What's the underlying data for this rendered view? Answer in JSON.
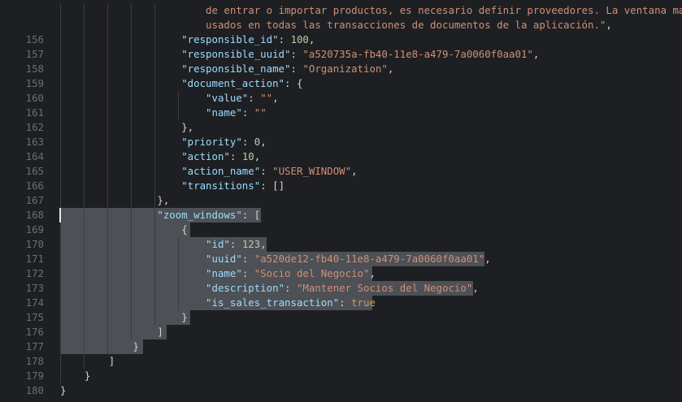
{
  "lines": [
    {
      "no": "",
      "indent": "                        ",
      "tokens": [
        {
          "t": "s",
          "v": "de entrar o importar productos, es necesario definir proveedores. La ventana mantie"
        }
      ]
    },
    {
      "no": "",
      "indent": "                        ",
      "tokens": [
        {
          "t": "s",
          "v": "usados en todas las transacciones de documentos de la aplicación.\""
        },
        {
          "t": "p",
          "v": ","
        }
      ]
    },
    {
      "no": "156",
      "indent": "                    ",
      "tokens": [
        {
          "t": "k",
          "v": "\"responsible_id\""
        },
        {
          "t": "p",
          "v": ": "
        },
        {
          "t": "n",
          "v": "100"
        },
        {
          "t": "p",
          "v": ","
        }
      ]
    },
    {
      "no": "157",
      "indent": "                    ",
      "tokens": [
        {
          "t": "k",
          "v": "\"responsible_uuid\""
        },
        {
          "t": "p",
          "v": ": "
        },
        {
          "t": "s",
          "v": "\"a520735a-fb40-11e8-a479-7a0060f0aa01\""
        },
        {
          "t": "p",
          "v": ","
        }
      ]
    },
    {
      "no": "158",
      "indent": "                    ",
      "tokens": [
        {
          "t": "k",
          "v": "\"responsible_name\""
        },
        {
          "t": "p",
          "v": ": "
        },
        {
          "t": "s",
          "v": "\"Organization\""
        },
        {
          "t": "p",
          "v": ","
        }
      ]
    },
    {
      "no": "159",
      "indent": "                    ",
      "tokens": [
        {
          "t": "k",
          "v": "\"document_action\""
        },
        {
          "t": "p",
          "v": ": {"
        }
      ]
    },
    {
      "no": "160",
      "indent": "                        ",
      "tokens": [
        {
          "t": "k",
          "v": "\"value\""
        },
        {
          "t": "p",
          "v": ": "
        },
        {
          "t": "s",
          "v": "\"\""
        },
        {
          "t": "p",
          "v": ","
        }
      ]
    },
    {
      "no": "161",
      "indent": "                        ",
      "tokens": [
        {
          "t": "k",
          "v": "\"name\""
        },
        {
          "t": "p",
          "v": ": "
        },
        {
          "t": "s",
          "v": "\"\""
        }
      ]
    },
    {
      "no": "162",
      "indent": "                    ",
      "tokens": [
        {
          "t": "p",
          "v": "},"
        }
      ]
    },
    {
      "no": "163",
      "indent": "                    ",
      "tokens": [
        {
          "t": "k",
          "v": "\"priority\""
        },
        {
          "t": "p",
          "v": ": "
        },
        {
          "t": "n",
          "v": "0"
        },
        {
          "t": "p",
          "v": ","
        }
      ]
    },
    {
      "no": "164",
      "indent": "                    ",
      "tokens": [
        {
          "t": "k",
          "v": "\"action\""
        },
        {
          "t": "p",
          "v": ": "
        },
        {
          "t": "n",
          "v": "10"
        },
        {
          "t": "p",
          "v": ","
        }
      ]
    },
    {
      "no": "165",
      "indent": "                    ",
      "tokens": [
        {
          "t": "k",
          "v": "\"action_name\""
        },
        {
          "t": "p",
          "v": ": "
        },
        {
          "t": "s",
          "v": "\"USER_WINDOW\""
        },
        {
          "t": "p",
          "v": ","
        }
      ]
    },
    {
      "no": "166",
      "indent": "                    ",
      "tokens": [
        {
          "t": "k",
          "v": "\"transitions\""
        },
        {
          "t": "p",
          "v": ": []"
        }
      ]
    },
    {
      "no": "167",
      "indent": "                ",
      "tokens": [
        {
          "t": "p",
          "v": "},"
        }
      ]
    },
    {
      "no": "168",
      "indent": "                ",
      "tokens": [
        {
          "t": "k",
          "v": "\"zoom_windows\""
        },
        {
          "t": "p",
          "v": ": ["
        }
      ]
    },
    {
      "no": "169",
      "indent": "                    ",
      "tokens": [
        {
          "t": "p",
          "v": "{"
        }
      ]
    },
    {
      "no": "170",
      "indent": "                        ",
      "tokens": [
        {
          "t": "k",
          "v": "\"id\""
        },
        {
          "t": "p",
          "v": ": "
        },
        {
          "t": "n",
          "v": "123"
        },
        {
          "t": "p",
          "v": ","
        }
      ]
    },
    {
      "no": "171",
      "indent": "                        ",
      "tokens": [
        {
          "t": "k",
          "v": "\"uuid\""
        },
        {
          "t": "p",
          "v": ": "
        },
        {
          "t": "s",
          "v": "\"a520de12-fb40-11e8-a479-7a0060f0aa01\""
        },
        {
          "t": "p",
          "v": ","
        }
      ]
    },
    {
      "no": "172",
      "indent": "                        ",
      "tokens": [
        {
          "t": "k",
          "v": "\"name\""
        },
        {
          "t": "p",
          "v": ": "
        },
        {
          "t": "s",
          "v": "\"Socio del Negocio\""
        },
        {
          "t": "p",
          "v": ","
        }
      ]
    },
    {
      "no": "173",
      "indent": "                        ",
      "tokens": [
        {
          "t": "k",
          "v": "\"description\""
        },
        {
          "t": "p",
          "v": ": "
        },
        {
          "t": "s",
          "v": "\"Mantener Socios del Negocio\""
        },
        {
          "t": "p",
          "v": ","
        }
      ]
    },
    {
      "no": "174",
      "indent": "                        ",
      "tokens": [
        {
          "t": "k",
          "v": "\"is_sales_transaction\""
        },
        {
          "t": "p",
          "v": ": "
        },
        {
          "t": "kw",
          "v": "true"
        }
      ]
    },
    {
      "no": "175",
      "indent": "                    ",
      "tokens": [
        {
          "t": "p",
          "v": "}"
        }
      ]
    },
    {
      "no": "176",
      "indent": "                ",
      "tokens": [
        {
          "t": "p",
          "v": "]"
        }
      ]
    },
    {
      "no": "177",
      "indent": "            ",
      "tokens": [
        {
          "t": "p",
          "v": "}"
        }
      ]
    },
    {
      "no": "178",
      "indent": "        ",
      "tokens": [
        {
          "t": "p",
          "v": "]"
        }
      ]
    },
    {
      "no": "179",
      "indent": "    ",
      "tokens": [
        {
          "t": "p",
          "v": "}"
        }
      ]
    },
    {
      "no": "180",
      "indent": "",
      "tokens": [
        {
          "t": "p",
          "v": "}"
        }
      ]
    }
  ]
}
